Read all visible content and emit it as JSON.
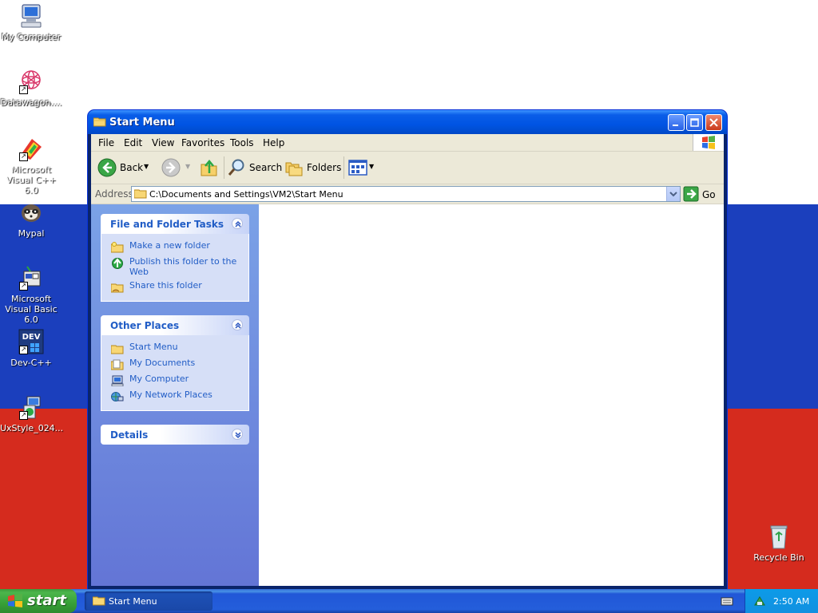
{
  "desktop": {
    "icons": [
      {
        "label": "My Computer"
      },
      {
        "label": "Datawagon...."
      },
      {
        "label": "Microsoft Visual C++ 6.0"
      },
      {
        "label": "Mypal"
      },
      {
        "label": "Microsoft Visual Basic 6.0"
      },
      {
        "label": "Dev-C++"
      },
      {
        "label": "UxStyle_024..."
      },
      {
        "label": "Recycle Bin"
      }
    ]
  },
  "window": {
    "title": "Start Menu",
    "menu": [
      "File",
      "Edit",
      "View",
      "Favorites",
      "Tools",
      "Help"
    ],
    "toolbar": {
      "back_label": "Back",
      "search_label": "Search",
      "folders_label": "Folders"
    },
    "address": {
      "label": "Address",
      "value": "C:\\Documents and Settings\\VM2\\Start Menu",
      "go_label": "Go"
    },
    "taskpane": {
      "file_tasks": {
        "title": "File and Folder Tasks",
        "items": [
          "Make a new folder",
          "Publish this folder to the Web",
          "Share this folder"
        ]
      },
      "other_places": {
        "title": "Other Places",
        "items": [
          "Start Menu",
          "My Documents",
          "My Computer",
          "My Network Places"
        ]
      },
      "details": {
        "title": "Details"
      }
    }
  },
  "taskbar": {
    "start_label": "start",
    "task_title": "Start Menu",
    "clock": "2:50 AM"
  },
  "colors": {
    "titlebar": "#0054e3",
    "taskpane_link": "#215dc6",
    "flag_white": "#ffffff",
    "flag_blue": "#1b3fbd",
    "flag_red": "#d52b1e",
    "start_green": "#37a037"
  }
}
